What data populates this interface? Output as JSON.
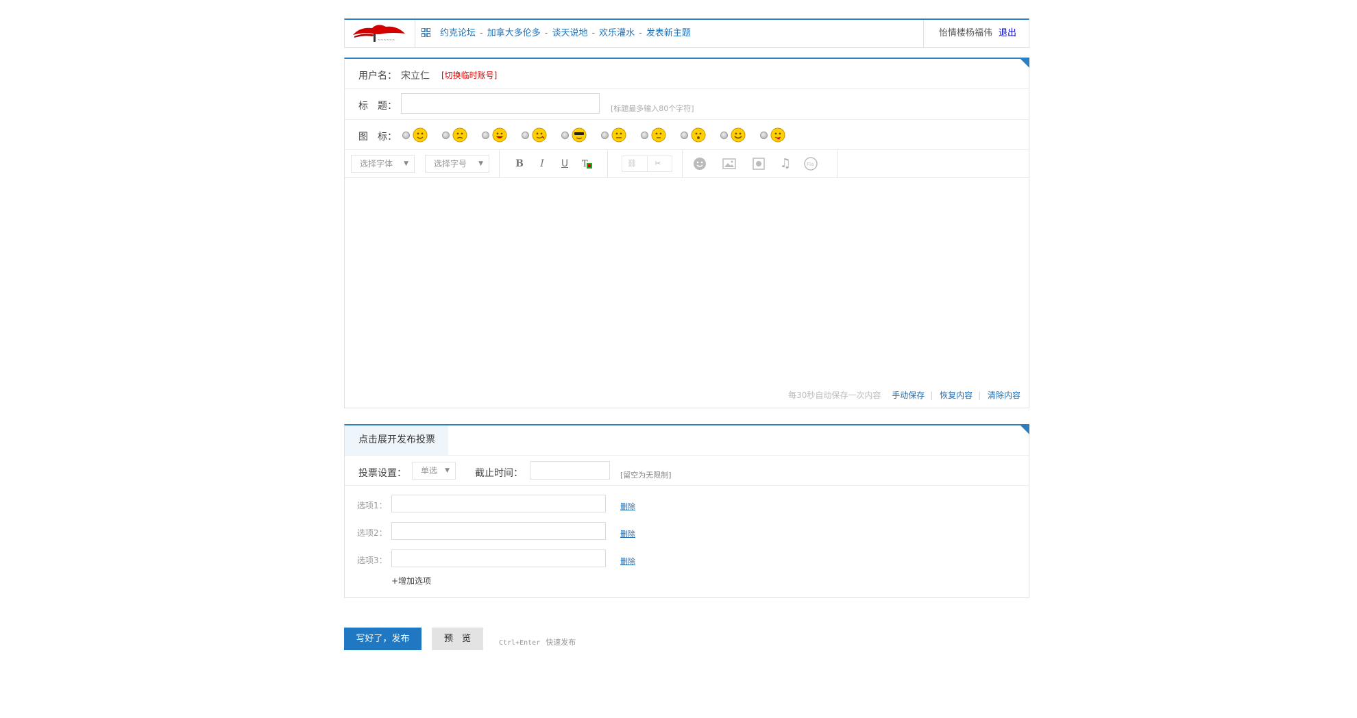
{
  "header": {
    "nav": [
      "约克论坛",
      "加拿大多伦多",
      "谈天说地",
      "欢乐灌水",
      "发表新主题"
    ],
    "nav_sep": "-",
    "username": "怡情楼杨福伟",
    "logout": "退出"
  },
  "form": {
    "user_label": "用户名：",
    "user_value": "宋立仁",
    "switch_account": "[切换临时账号]",
    "title_label": "标　题：",
    "title_value": "",
    "title_hint": "[标题最多输入80个字符]",
    "icon_label": "图　标：",
    "icons": [
      "smile-face-icon",
      "sad-face-icon",
      "grin-face-icon",
      "wink-face-icon",
      "cool-face-icon",
      "blush-face-icon",
      "neutral-face-icon",
      "surprised-face-icon",
      "laugh-face-icon",
      "tongue-face-icon"
    ],
    "toolbar": {
      "font_select": "选择字体",
      "size_select": "选择字号",
      "bold": "B",
      "italic": "I",
      "underline": "U"
    },
    "autosave_note": "每30秒自动保存一次内容",
    "save": "手动保存",
    "restore": "恢复内容",
    "clear": "清除内容"
  },
  "poll": {
    "tab": "点击展开发布投票",
    "setting_label": "投票设置：",
    "type_value": "单选",
    "deadline_label": "截止时间：",
    "deadline_value": "",
    "deadline_hint": "[留空为无限制]",
    "options": [
      {
        "label": "选项1：",
        "value": "",
        "delete": "删除"
      },
      {
        "label": "选项2：",
        "value": "",
        "delete": "删除"
      },
      {
        "label": "选项3：",
        "value": "",
        "delete": "删除"
      }
    ],
    "add_option": "+增加选项"
  },
  "actions": {
    "submit": "写好了，发布",
    "preview": "预　览",
    "shortcut_key": "Ctrl+Enter",
    "shortcut_desc": "快速发布"
  },
  "colors": {
    "accent": "#2b7fc1",
    "link": "#1f6fb6",
    "warn": "#e00000"
  }
}
